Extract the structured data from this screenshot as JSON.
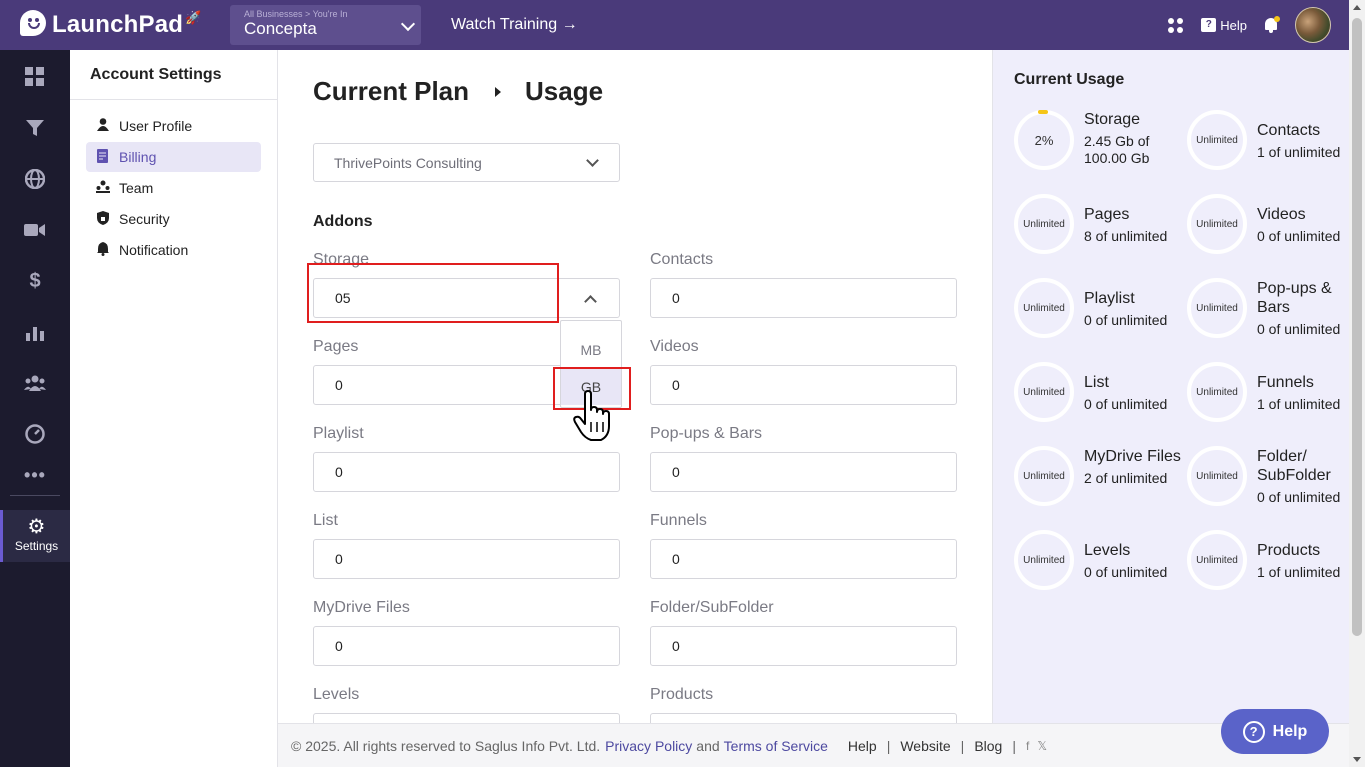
{
  "header": {
    "logo_text": "LaunchPad",
    "business_breadcrumb": "All Businesses > You're In",
    "business_name": "Concepta",
    "watch_training": "Watch Training →",
    "help": "Help"
  },
  "rail": {
    "settings_label": "Settings"
  },
  "settings_nav": {
    "title": "Account Settings",
    "items": [
      {
        "label": "User Profile"
      },
      {
        "label": "Billing"
      },
      {
        "label": "Team"
      },
      {
        "label": "Security"
      },
      {
        "label": "Notification"
      }
    ]
  },
  "main": {
    "breadcrumb": [
      "Current Plan",
      "Usage"
    ],
    "company_select": "ThrivePoints Consulting",
    "addons_title": "Addons",
    "fields": {
      "storage": {
        "label": "Storage",
        "value": "05"
      },
      "contacts": {
        "label": "Contacts",
        "value": "0"
      },
      "pages": {
        "label": "Pages",
        "value": "0"
      },
      "videos": {
        "label": "Videos",
        "value": "0"
      },
      "playlist": {
        "label": "Playlist",
        "value": "0"
      },
      "popups": {
        "label": "Pop-ups & Bars",
        "value": "0"
      },
      "list": {
        "label": "List",
        "value": "0"
      },
      "funnels": {
        "label": "Funnels",
        "value": "0"
      },
      "mydrive": {
        "label": "MyDrive Files",
        "value": "0"
      },
      "folder": {
        "label": "Folder/SubFolder",
        "value": "0"
      },
      "levels": {
        "label": "Levels"
      },
      "products": {
        "label": "Products"
      }
    },
    "unit_options": [
      "MB",
      "GB"
    ],
    "unit_highlighted": "GB"
  },
  "usage": {
    "title": "Current Usage",
    "items": [
      {
        "ring": "2%",
        "name": "Storage",
        "value": "2.45 Gb of 100.00 Gb",
        "percent": 2
      },
      {
        "ring": "Unlimited",
        "name": "Contacts",
        "value": "1 of unlimited"
      },
      {
        "ring": "Unlimited",
        "name": "Pages",
        "value": "8 of unlimited"
      },
      {
        "ring": "Unlimited",
        "name": "Videos",
        "value": "0 of unlimited"
      },
      {
        "ring": "Unlimited",
        "name": "Playlist",
        "value": "0 of unlimited"
      },
      {
        "ring": "Unlimited",
        "name": "Pop-ups & Bars",
        "value": "0 of unlimited"
      },
      {
        "ring": "Unlimited",
        "name": "List",
        "value": "0 of unlimited"
      },
      {
        "ring": "Unlimited",
        "name": "Funnels",
        "value": "1 of unlimited"
      },
      {
        "ring": "Unlimited",
        "name": "MyDrive Files",
        "value": "2 of unlimited"
      },
      {
        "ring": "Unlimited",
        "name": "Folder/ SubFolder",
        "value": "0 of unlimited"
      },
      {
        "ring": "Unlimited",
        "name": "Levels",
        "value": "0 of unlimited"
      },
      {
        "ring": "Unlimited",
        "name": "Products",
        "value": "1 of unlimited"
      }
    ]
  },
  "footer": {
    "copyright": "© 2025. All rights reserved to Saglus Info Pvt. Ltd.",
    "privacy": "Privacy Policy",
    "and": "and",
    "terms": "Terms of Service",
    "help": "Help",
    "website": "Website",
    "blog": "Blog"
  },
  "help_button": "Help",
  "colors": {
    "topbar": "#4a3a7a",
    "rail": "#1c1b2e",
    "accent": "#5f52b0",
    "usage_bg": "#efeefb",
    "highlight_red": "#e01e1e"
  }
}
